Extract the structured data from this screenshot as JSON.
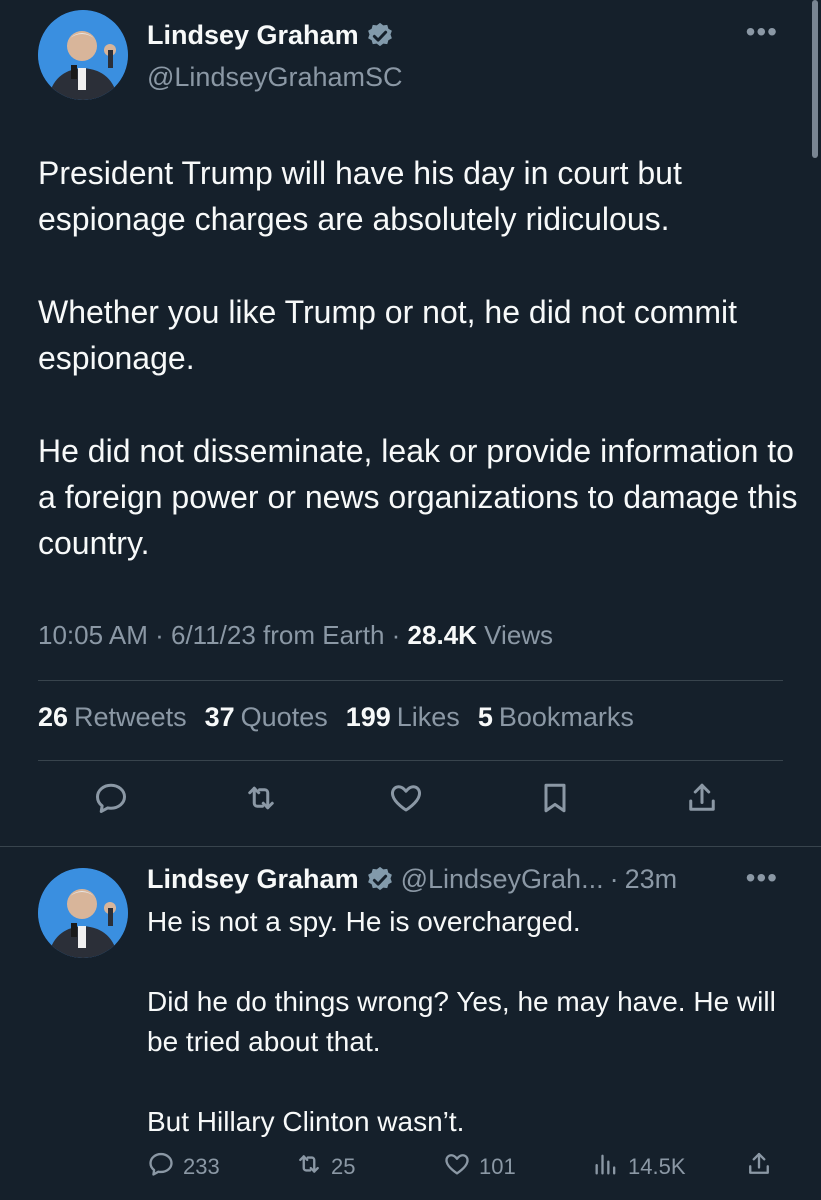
{
  "main_tweet": {
    "author_name": "Lindsey Graham",
    "author_handle": "@LindseyGrahamSC",
    "more_label": "•••",
    "paragraphs": [
      "President Trump will have his day in court but espionage charges are absolutely ridiculous.",
      "Whether you like Trump or not, he did not commit espionage.",
      "He did not disseminate, leak or provide information to a foreign power or news organizations to damage this country."
    ],
    "time": "10:05 AM",
    "date": "6/11/23",
    "source": "from Earth",
    "views_count": "28.4K",
    "views_label": "Views",
    "stats": {
      "retweets_count": "26",
      "retweets_label": "Retweets",
      "quotes_count": "37",
      "quotes_label": "Quotes",
      "likes_count": "199",
      "likes_label": "Likes",
      "bookmarks_count": "5",
      "bookmarks_label": "Bookmarks"
    },
    "action_icons": [
      "reply-icon",
      "retweet-icon",
      "like-icon",
      "bookmark-icon",
      "share-icon"
    ]
  },
  "reply_tweet": {
    "author_name": "Lindsey Graham",
    "author_handle": "@LindseyGrah...",
    "time_ago": "23m",
    "more_label": "•••",
    "paragraphs": [
      "He is not a spy.  He is overcharged.",
      "Did he do things wrong? Yes, he may have.  He will be tried about that.",
      "But Hillary Clinton wasn’t."
    ],
    "reply_count": "233",
    "retweet_count": "25",
    "like_count": "101",
    "views_count": "14.5K"
  },
  "colors": {
    "background": "#15202b",
    "text_primary": "#f7f9f9",
    "text_secondary": "#8b98a5",
    "divider": "#38444d",
    "verified": "#829aab"
  }
}
